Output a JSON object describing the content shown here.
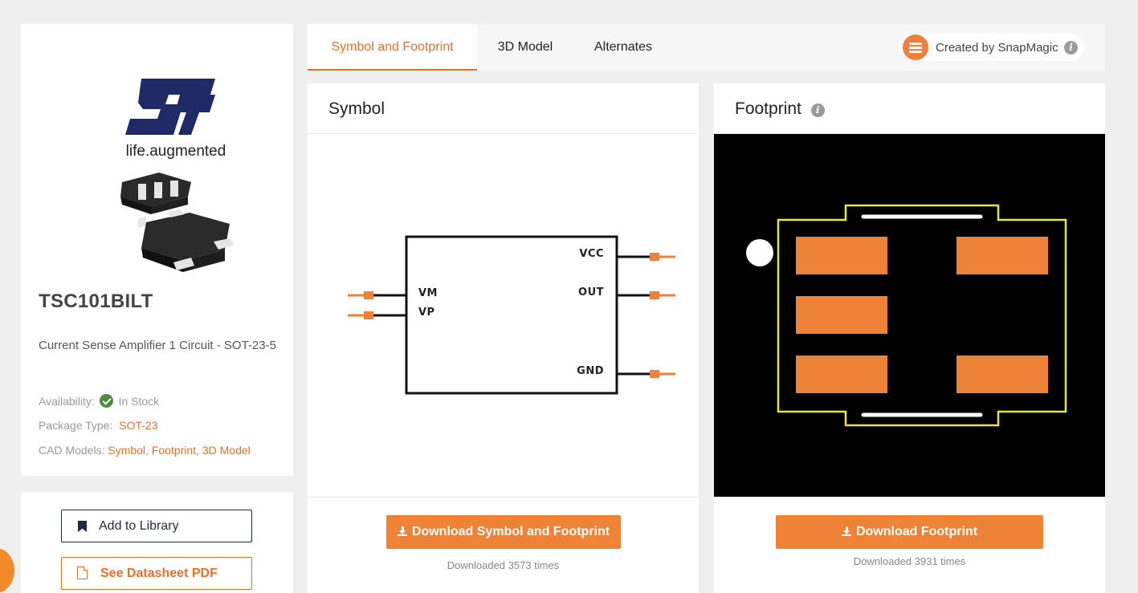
{
  "part": {
    "number": "TSC101BILT",
    "description": "Current Sense Amplifier 1 Circuit - SOT-23-5",
    "brand_tagline": "life.augmented",
    "availability_label": "Availability:",
    "availability_value": "In Stock",
    "package_label": "Package Type:",
    "package_value": "SOT-23",
    "cad_label": "CAD Models:",
    "cad_links": [
      "Symbol",
      "Footprint",
      "3D Model"
    ]
  },
  "actions": {
    "add_library": "Add to Library",
    "datasheet": "See Datasheet PDF"
  },
  "tabs": [
    {
      "label": "Symbol and Footprint",
      "active": true
    },
    {
      "label": "3D Model",
      "active": false
    },
    {
      "label": "Alternates",
      "active": false
    }
  ],
  "snapmagic": {
    "text": "Created by SnapMagic"
  },
  "symbol_panel": {
    "title": "Symbol",
    "pins_left": [
      "VM",
      "VP"
    ],
    "pins_right": [
      "VCC",
      "OUT",
      "GND"
    ],
    "download_label": "Download Symbol and Footprint",
    "download_count": "Downloaded 3573 times"
  },
  "footprint_panel": {
    "title": "Footprint",
    "download_label": "Download Footprint",
    "download_count": "Downloaded 3931 times"
  },
  "colors": {
    "accent": "#e8702a",
    "pad": "#ee8237",
    "silkscreen": "#e6e63c",
    "brand_navy": "#1f2a66",
    "in_stock": "#4a8a3b"
  }
}
